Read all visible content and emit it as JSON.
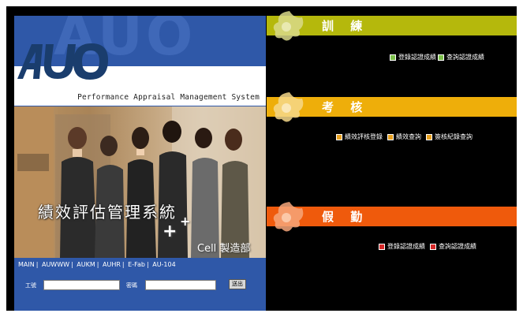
{
  "brand": {
    "logo_text": "AUO",
    "subtitle": "Performance Appraisal Management System"
  },
  "hero": {
    "title": "績效評估管理系統",
    "department": "Cell 製造部"
  },
  "nav_links": [
    "MAIN",
    "AUWWW",
    "AUKM",
    "AUHR",
    "E-Fab",
    "AU-104"
  ],
  "login": {
    "user_label": "工號",
    "password_label": "密碼",
    "button_label": "送出"
  },
  "sections": [
    {
      "title": "訓 練",
      "color": "#b5b80c",
      "bullet_color": "#7cc04a",
      "links": [
        "登錄認證成績",
        "查詢認證成績"
      ]
    },
    {
      "title": "考 核",
      "color": "#eeae0a",
      "bullet_color": "#e7a020",
      "links": [
        "績效評核登錄",
        "績效查詢",
        "簽核紀錄查詢"
      ]
    },
    {
      "title": "假 勤",
      "color": "#ef5a0c",
      "bullet_color": "#d62828",
      "links": [
        "登錄認證成績",
        "查詢認證成績"
      ]
    }
  ]
}
